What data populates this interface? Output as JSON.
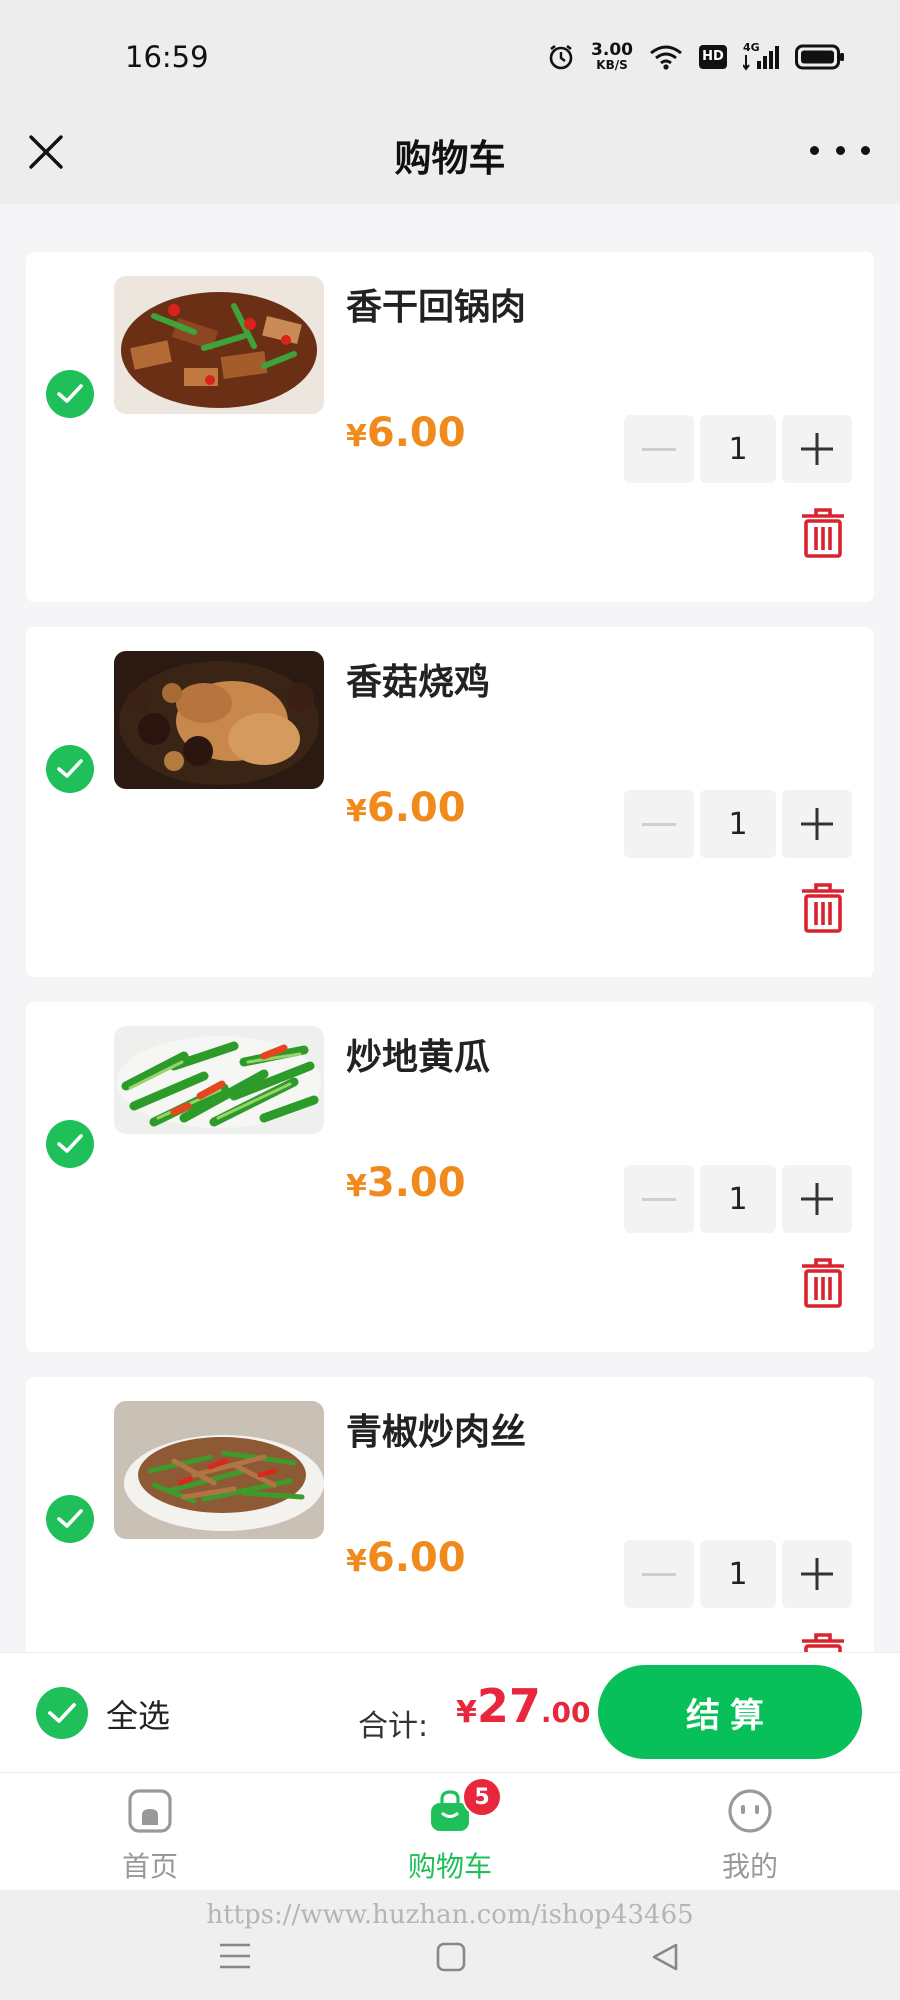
{
  "status_bar": {
    "time": "16:59",
    "net_speed_value": "3.00",
    "net_speed_unit": "KB/S",
    "hd_label": "HD",
    "network_label": "4G"
  },
  "nav": {
    "title": "购物车"
  },
  "cart": {
    "items": [
      {
        "name": "香干回锅肉",
        "currency": "¥",
        "price": "6.00",
        "quantity": "1",
        "checked": true
      },
      {
        "name": "香菇烧鸡",
        "currency": "¥",
        "price": "6.00",
        "quantity": "1",
        "checked": true
      },
      {
        "name": "炒地黄瓜",
        "currency": "¥",
        "price": "3.00",
        "quantity": "1",
        "checked": true
      },
      {
        "name": "青椒炒肉丝",
        "currency": "¥",
        "price": "6.00",
        "quantity": "1",
        "checked": true
      }
    ]
  },
  "checkout": {
    "select_all_label": "全选",
    "total_label": "合计:",
    "total_currency": "¥",
    "total_integer": "27",
    "total_decimal": ".00",
    "button_label": "结算"
  },
  "tabs": [
    {
      "label": "首页",
      "icon": "home-icon",
      "active": false
    },
    {
      "label": "购物车",
      "icon": "cart-bag-icon",
      "active": true,
      "badge": "5"
    },
    {
      "label": "我的",
      "icon": "profile-icon",
      "active": false
    }
  ],
  "watermark": "https://www.huzhan.com/ishop43465",
  "colors": {
    "accent_green": "#1fbf5a",
    "price_orange": "#f08a1c",
    "total_red": "#e8273c",
    "delete_red": "#d9232e"
  }
}
